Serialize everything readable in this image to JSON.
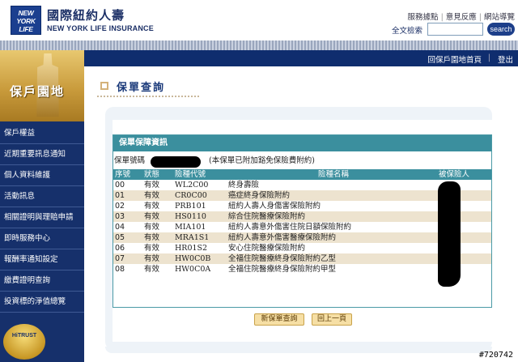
{
  "brand": {
    "logo_text": [
      "NEW",
      "YORK",
      "LIFE"
    ],
    "name_cn": "國際紐約人壽",
    "name_en": "NEW YORK LIFE INSURANCE"
  },
  "top_links": [
    "服務據點",
    "意見反應",
    "網站導覽"
  ],
  "search": {
    "label": "全文檢索",
    "button": "search",
    "value": ""
  },
  "nav": {
    "home": "回保戶園地首頁",
    "logout": "登出"
  },
  "sidebar": {
    "title": "保戶園地",
    "items": [
      {
        "label": "保戶權益"
      },
      {
        "label": "近期重要訊息通知"
      },
      {
        "label": "個人資料維護"
      },
      {
        "label": "活動訊息"
      },
      {
        "label": "相關證明與理賠申請"
      },
      {
        "label": "即時服務中心"
      },
      {
        "label": "報酬率通知設定"
      },
      {
        "label": "繳費證明查詢"
      },
      {
        "label": "投資標的淨值總覽"
      }
    ],
    "badge_text": "HiTRUST"
  },
  "page": {
    "title": "保單查詢"
  },
  "section": {
    "title": "保單保障資訊",
    "policy_label": "保單號碼",
    "policy_note": "(本保單已附加豁免保險費附約)"
  },
  "table": {
    "headers": [
      "序號",
      "狀態",
      "險種代號",
      "險種名稱",
      "被保險人"
    ],
    "rows": [
      {
        "no": "00",
        "status": "有效",
        "code": "WL2C00",
        "name": "終身壽險"
      },
      {
        "no": "01",
        "status": "有效",
        "code": "CR0C00",
        "name": "癌症終身保險附約"
      },
      {
        "no": "02",
        "status": "有效",
        "code": "PRB101",
        "name": "紐約人壽人身傷害保險附約"
      },
      {
        "no": "03",
        "status": "有效",
        "code": "HS0110",
        "name": "綜合住院醫療保險附約"
      },
      {
        "no": "04",
        "status": "有效",
        "code": "MIA101",
        "name": "紐約人壽意外傷害住院日額保險附約"
      },
      {
        "no": "05",
        "status": "有效",
        "code": "MRA1S1",
        "name": "紐約人壽意外傷害醫療保險附約"
      },
      {
        "no": "06",
        "status": "有效",
        "code": "HR01S2",
        "name": "安心住院醫療保險附約"
      },
      {
        "no": "07",
        "status": "有效",
        "code": "HW0C0B",
        "name": "全福住院醫療終身保險附約乙型"
      },
      {
        "no": "08",
        "status": "有效",
        "code": "HW0C0A",
        "name": "全福住院醫療終身保險附約甲型"
      }
    ]
  },
  "buttons": {
    "new_query": "新保單查詢",
    "back": "回上一頁"
  },
  "watermark": "#720742",
  "colors": {
    "nav_bg": "#0f2d6e",
    "section_head": "#3b8f9e",
    "row_alt": "#ede3cf"
  }
}
